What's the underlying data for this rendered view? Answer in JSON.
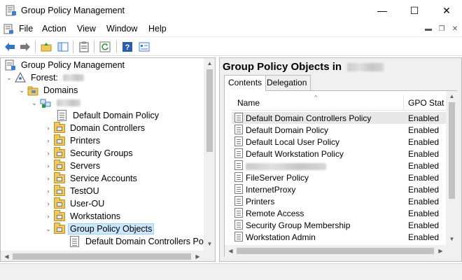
{
  "window": {
    "title": "Group Policy Management",
    "minimize_glyph": "—",
    "maximize_glyph": "☐",
    "close_glyph": "✕"
  },
  "menu": {
    "items": [
      "File",
      "Action",
      "View",
      "Window",
      "Help"
    ]
  },
  "toolbar": {
    "icons": [
      "back-arrow-icon",
      "forward-arrow-icon",
      "up-folder-icon",
      "show-hide-tree-icon",
      "properties-icon",
      "refresh-icon",
      "help-icon",
      "view-icon"
    ]
  },
  "tree": {
    "root": "Group Policy Management",
    "forest_label": "Forest:",
    "domains": "Domains",
    "children": [
      "Default Domain Policy",
      "Domain Controllers",
      "Printers",
      "Security Groups",
      "Servers",
      "Service Accounts",
      "TestOU",
      "User-OU",
      "Workstations",
      "Group Policy Objects",
      "Default Domain Controllers Polic"
    ],
    "selected": "Group Policy Objects"
  },
  "right_pane": {
    "title": "Group Policy Objects in",
    "tabs": [
      "Contents",
      "Delegation"
    ],
    "active_tab": "Contents",
    "columns": [
      "Name",
      "GPO Stat"
    ],
    "rows": [
      {
        "name": "Default Domain Controllers Policy",
        "status": "Enabled"
      },
      {
        "name": "Default Domain Policy",
        "status": "Enabled"
      },
      {
        "name": "Default Local User Policy",
        "status": "Enabled"
      },
      {
        "name": "Default Workstation Policy",
        "status": "Enabled"
      },
      {
        "name": "",
        "status": "Enabled"
      },
      {
        "name": "FileServer Policy",
        "status": "Enabled"
      },
      {
        "name": "InternetProxy",
        "status": "Enabled"
      },
      {
        "name": "Printers",
        "status": "Enabled"
      },
      {
        "name": "Remote Access",
        "status": "Enabled"
      },
      {
        "name": "Security Group Membership",
        "status": "Enabled"
      },
      {
        "name": "Workstation Admin",
        "status": "Enabled"
      }
    ]
  }
}
